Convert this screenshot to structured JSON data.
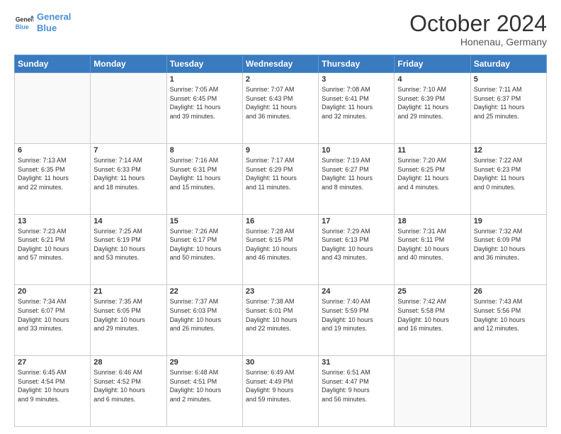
{
  "header": {
    "logo_line1": "General",
    "logo_line2": "Blue",
    "month": "October 2024",
    "location": "Honenau, Germany"
  },
  "weekdays": [
    "Sunday",
    "Monday",
    "Tuesday",
    "Wednesday",
    "Thursday",
    "Friday",
    "Saturday"
  ],
  "weeks": [
    [
      {
        "day": "",
        "lines": []
      },
      {
        "day": "",
        "lines": []
      },
      {
        "day": "1",
        "lines": [
          "Sunrise: 7:05 AM",
          "Sunset: 6:45 PM",
          "Daylight: 11 hours",
          "and 39 minutes."
        ]
      },
      {
        "day": "2",
        "lines": [
          "Sunrise: 7:07 AM",
          "Sunset: 6:43 PM",
          "Daylight: 11 hours",
          "and 36 minutes."
        ]
      },
      {
        "day": "3",
        "lines": [
          "Sunrise: 7:08 AM",
          "Sunset: 6:41 PM",
          "Daylight: 11 hours",
          "and 32 minutes."
        ]
      },
      {
        "day": "4",
        "lines": [
          "Sunrise: 7:10 AM",
          "Sunset: 6:39 PM",
          "Daylight: 11 hours",
          "and 29 minutes."
        ]
      },
      {
        "day": "5",
        "lines": [
          "Sunrise: 7:11 AM",
          "Sunset: 6:37 PM",
          "Daylight: 11 hours",
          "and 25 minutes."
        ]
      }
    ],
    [
      {
        "day": "6",
        "lines": [
          "Sunrise: 7:13 AM",
          "Sunset: 6:35 PM",
          "Daylight: 11 hours",
          "and 22 minutes."
        ]
      },
      {
        "day": "7",
        "lines": [
          "Sunrise: 7:14 AM",
          "Sunset: 6:33 PM",
          "Daylight: 11 hours",
          "and 18 minutes."
        ]
      },
      {
        "day": "8",
        "lines": [
          "Sunrise: 7:16 AM",
          "Sunset: 6:31 PM",
          "Daylight: 11 hours",
          "and 15 minutes."
        ]
      },
      {
        "day": "9",
        "lines": [
          "Sunrise: 7:17 AM",
          "Sunset: 6:29 PM",
          "Daylight: 11 hours",
          "and 11 minutes."
        ]
      },
      {
        "day": "10",
        "lines": [
          "Sunrise: 7:19 AM",
          "Sunset: 6:27 PM",
          "Daylight: 11 hours",
          "and 8 minutes."
        ]
      },
      {
        "day": "11",
        "lines": [
          "Sunrise: 7:20 AM",
          "Sunset: 6:25 PM",
          "Daylight: 11 hours",
          "and 4 minutes."
        ]
      },
      {
        "day": "12",
        "lines": [
          "Sunrise: 7:22 AM",
          "Sunset: 6:23 PM",
          "Daylight: 11 hours",
          "and 0 minutes."
        ]
      }
    ],
    [
      {
        "day": "13",
        "lines": [
          "Sunrise: 7:23 AM",
          "Sunset: 6:21 PM",
          "Daylight: 10 hours",
          "and 57 minutes."
        ]
      },
      {
        "day": "14",
        "lines": [
          "Sunrise: 7:25 AM",
          "Sunset: 6:19 PM",
          "Daylight: 10 hours",
          "and 53 minutes."
        ]
      },
      {
        "day": "15",
        "lines": [
          "Sunrise: 7:26 AM",
          "Sunset: 6:17 PM",
          "Daylight: 10 hours",
          "and 50 minutes."
        ]
      },
      {
        "day": "16",
        "lines": [
          "Sunrise: 7:28 AM",
          "Sunset: 6:15 PM",
          "Daylight: 10 hours",
          "and 46 minutes."
        ]
      },
      {
        "day": "17",
        "lines": [
          "Sunrise: 7:29 AM",
          "Sunset: 6:13 PM",
          "Daylight: 10 hours",
          "and 43 minutes."
        ]
      },
      {
        "day": "18",
        "lines": [
          "Sunrise: 7:31 AM",
          "Sunset: 6:11 PM",
          "Daylight: 10 hours",
          "and 40 minutes."
        ]
      },
      {
        "day": "19",
        "lines": [
          "Sunrise: 7:32 AM",
          "Sunset: 6:09 PM",
          "Daylight: 10 hours",
          "and 36 minutes."
        ]
      }
    ],
    [
      {
        "day": "20",
        "lines": [
          "Sunrise: 7:34 AM",
          "Sunset: 6:07 PM",
          "Daylight: 10 hours",
          "and 33 minutes."
        ]
      },
      {
        "day": "21",
        "lines": [
          "Sunrise: 7:35 AM",
          "Sunset: 6:05 PM",
          "Daylight: 10 hours",
          "and 29 minutes."
        ]
      },
      {
        "day": "22",
        "lines": [
          "Sunrise: 7:37 AM",
          "Sunset: 6:03 PM",
          "Daylight: 10 hours",
          "and 26 minutes."
        ]
      },
      {
        "day": "23",
        "lines": [
          "Sunrise: 7:38 AM",
          "Sunset: 6:01 PM",
          "Daylight: 10 hours",
          "and 22 minutes."
        ]
      },
      {
        "day": "24",
        "lines": [
          "Sunrise: 7:40 AM",
          "Sunset: 5:59 PM",
          "Daylight: 10 hours",
          "and 19 minutes."
        ]
      },
      {
        "day": "25",
        "lines": [
          "Sunrise: 7:42 AM",
          "Sunset: 5:58 PM",
          "Daylight: 10 hours",
          "and 16 minutes."
        ]
      },
      {
        "day": "26",
        "lines": [
          "Sunrise: 7:43 AM",
          "Sunset: 5:56 PM",
          "Daylight: 10 hours",
          "and 12 minutes."
        ]
      }
    ],
    [
      {
        "day": "27",
        "lines": [
          "Sunrise: 6:45 AM",
          "Sunset: 4:54 PM",
          "Daylight: 10 hours",
          "and 9 minutes."
        ]
      },
      {
        "day": "28",
        "lines": [
          "Sunrise: 6:46 AM",
          "Sunset: 4:52 PM",
          "Daylight: 10 hours",
          "and 6 minutes."
        ]
      },
      {
        "day": "29",
        "lines": [
          "Sunrise: 6:48 AM",
          "Sunset: 4:51 PM",
          "Daylight: 10 hours",
          "and 2 minutes."
        ]
      },
      {
        "day": "30",
        "lines": [
          "Sunrise: 6:49 AM",
          "Sunset: 4:49 PM",
          "Daylight: 9 hours",
          "and 59 minutes."
        ]
      },
      {
        "day": "31",
        "lines": [
          "Sunrise: 6:51 AM",
          "Sunset: 4:47 PM",
          "Daylight: 9 hours",
          "and 56 minutes."
        ]
      },
      {
        "day": "",
        "lines": []
      },
      {
        "day": "",
        "lines": []
      }
    ]
  ]
}
